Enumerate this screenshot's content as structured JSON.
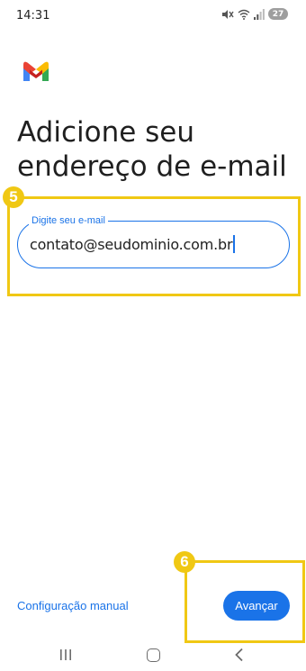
{
  "status_bar": {
    "time": "14:31",
    "battery_level": "27",
    "icons": [
      "mute-icon",
      "wifi-icon",
      "signal-icon",
      "battery-icon"
    ]
  },
  "app": {
    "logo": "gmail-logo",
    "heading": "Adicione seu endereço de e-mail"
  },
  "email_field": {
    "label": "Digite seu e-mail",
    "value": "contato@seudominio.com.br"
  },
  "footer": {
    "manual_setup_label": "Configuração manual",
    "next_label": "Avançar"
  },
  "annotations": [
    {
      "number": "5",
      "target": "email-field"
    },
    {
      "number": "6",
      "target": "next-button"
    }
  ],
  "colors": {
    "accent": "#1a73e8",
    "annotation": "#f0c814",
    "text": "#1f1f1f"
  }
}
